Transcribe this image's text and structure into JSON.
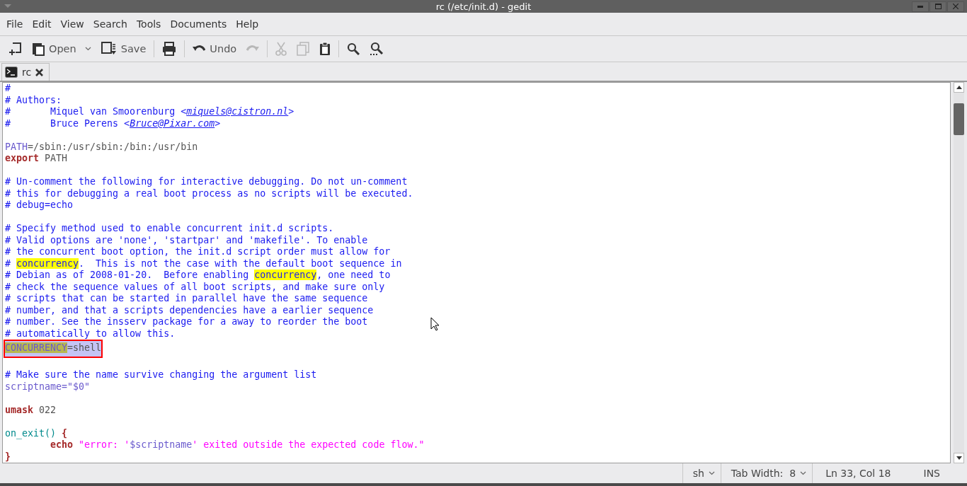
{
  "window": {
    "title": "rc (/etc/init.d) - gedit"
  },
  "menu": [
    {
      "label": "File"
    },
    {
      "label": "Edit"
    },
    {
      "label": "View"
    },
    {
      "label": "Search"
    },
    {
      "label": "Tools"
    },
    {
      "label": "Documents"
    },
    {
      "label": "Help"
    }
  ],
  "toolbar": [
    {
      "kind": "new",
      "disabled": false
    },
    {
      "kind": "open",
      "label": "Open",
      "disabled": false
    },
    {
      "kind": "save",
      "label": "Save",
      "disabled": false
    },
    {
      "kind": "separator"
    },
    {
      "kind": "print",
      "disabled": false
    },
    {
      "kind": "separator"
    },
    {
      "kind": "undo",
      "label": "Undo",
      "disabled": false
    },
    {
      "kind": "redo",
      "disabled": true
    },
    {
      "kind": "separator"
    },
    {
      "kind": "cut",
      "disabled": true
    },
    {
      "kind": "copy",
      "disabled": true
    },
    {
      "kind": "paste",
      "disabled": false
    },
    {
      "kind": "separator"
    },
    {
      "kind": "find",
      "disabled": false
    },
    {
      "kind": "replace",
      "disabled": false
    }
  ],
  "tabs": [
    {
      "label": "rc",
      "selected": true
    }
  ],
  "code": {
    "lines": [
      {
        "selected": false,
        "boxed": false,
        "segments": [
          {
            "text": "#",
            "kind": "comment",
            "match": false
          }
        ]
      },
      {
        "selected": false,
        "boxed": false,
        "segments": [
          {
            "text": "# Authors:",
            "kind": "comment",
            "match": false
          }
        ]
      },
      {
        "selected": false,
        "boxed": false,
        "segments": [
          {
            "text": "#\tMiquel van Smoorenburg <",
            "kind": "comment",
            "match": false
          },
          {
            "text": "miquels@cistron.nl",
            "kind": "link",
            "match": false
          },
          {
            "text": ">",
            "kind": "comment",
            "match": false
          }
        ]
      },
      {
        "selected": false,
        "boxed": false,
        "segments": [
          {
            "text": "#\tBruce Perens <",
            "kind": "comment",
            "match": false
          },
          {
            "text": "Bruce@Pixar.com",
            "kind": "link",
            "match": false
          },
          {
            "text": ">",
            "kind": "comment",
            "match": false
          }
        ]
      },
      {
        "selected": false,
        "boxed": false
      },
      {
        "selected": false,
        "boxed": false,
        "segments": [
          {
            "text": "PATH",
            "kind": "variable",
            "match": false
          },
          {
            "text": "=/sbin:/usr/sbin:/bin:/usr/bin",
            "kind": "plain",
            "match": false
          }
        ]
      },
      {
        "selected": false,
        "boxed": false,
        "segments": [
          {
            "text": "export",
            "kind": "keyword",
            "match": false
          },
          {
            "text": " PATH",
            "kind": "plain",
            "match": false
          }
        ]
      },
      {
        "selected": false,
        "boxed": false
      },
      {
        "selected": false,
        "boxed": false,
        "segments": [
          {
            "text": "# Un-comment the following for interactive debugging. Do not un-comment",
            "kind": "comment",
            "match": false
          }
        ]
      },
      {
        "selected": false,
        "boxed": false,
        "segments": [
          {
            "text": "# this for debugging a real boot process as no scripts will be executed.",
            "kind": "comment",
            "match": false
          }
        ]
      },
      {
        "selected": false,
        "boxed": false,
        "segments": [
          {
            "text": "# debug=echo",
            "kind": "comment",
            "match": false
          }
        ]
      },
      {
        "selected": false,
        "boxed": false
      },
      {
        "selected": false,
        "boxed": false,
        "segments": [
          {
            "text": "# Specify method used to enable concurrent init.d scripts.",
            "kind": "comment",
            "match": false
          }
        ]
      },
      {
        "selected": false,
        "boxed": false,
        "segments": [
          {
            "text": "# Valid options are 'none', 'startpar' and 'makefile'. To enable",
            "kind": "comment",
            "match": false
          }
        ]
      },
      {
        "selected": false,
        "boxed": false,
        "segments": [
          {
            "text": "# the concurrent boot option, the init.d script order must allow for",
            "kind": "comment",
            "match": false
          }
        ]
      },
      {
        "selected": false,
        "boxed": false,
        "segments": [
          {
            "text": "# ",
            "kind": "comment",
            "match": false
          },
          {
            "text": "concurrency",
            "kind": "comment",
            "match": true
          },
          {
            "text": ".  This is not the case with the default boot sequence in",
            "kind": "comment",
            "match": false
          }
        ]
      },
      {
        "selected": false,
        "boxed": false,
        "segments": [
          {
            "text": "# Debian as of 2008-01-20.  Before enabling ",
            "kind": "comment",
            "match": false
          },
          {
            "text": "concurrency",
            "kind": "comment",
            "match": true
          },
          {
            "text": ", one need to",
            "kind": "comment",
            "match": false
          }
        ]
      },
      {
        "selected": false,
        "boxed": false,
        "segments": [
          {
            "text": "# check the sequence values of all boot scripts, and make sure only",
            "kind": "comment",
            "match": false
          }
        ]
      },
      {
        "selected": false,
        "boxed": false,
        "segments": [
          {
            "text": "# scripts that can be started in parallel have the same sequence",
            "kind": "comment",
            "match": false
          }
        ]
      },
      {
        "selected": false,
        "boxed": false,
        "segments": [
          {
            "text": "# number, and that a scripts dependencies have a earlier sequence",
            "kind": "comment",
            "match": false
          }
        ]
      },
      {
        "selected": false,
        "boxed": false,
        "segments": [
          {
            "text": "# number. See the insserv package for a away to reorder the boot",
            "kind": "comment",
            "match": false
          }
        ]
      },
      {
        "selected": false,
        "boxed": false,
        "segments": [
          {
            "text": "# automatically to allow this.",
            "kind": "comment",
            "match": false
          }
        ]
      },
      {
        "selected": true,
        "boxed": true,
        "segments": [
          {
            "text": "CONCURRENCY",
            "kind": "variable",
            "match": true
          },
          {
            "text": "=shell",
            "kind": "plain",
            "match": false
          }
        ]
      },
      {
        "selected": false,
        "boxed": false
      },
      {
        "selected": false,
        "boxed": false,
        "segments": [
          {
            "text": "# Make sure the name survive changing the argument list",
            "kind": "comment",
            "match": false
          }
        ]
      },
      {
        "selected": false,
        "boxed": false,
        "segments": [
          {
            "text": "scriptname=\"$0\"",
            "kind": "variable",
            "match": false
          }
        ]
      },
      {
        "selected": false,
        "boxed": false
      },
      {
        "selected": false,
        "boxed": false,
        "segments": [
          {
            "text": "umask",
            "kind": "keyword",
            "match": false
          },
          {
            "text": " 022",
            "kind": "plain",
            "match": false
          }
        ]
      },
      {
        "selected": false,
        "boxed": false
      },
      {
        "selected": false,
        "boxed": false,
        "segments": [
          {
            "text": "on_exit()",
            "kind": "function",
            "match": false
          },
          {
            "text": " {",
            "kind": "keyword",
            "match": false
          }
        ]
      },
      {
        "selected": false,
        "boxed": false,
        "segments": [
          {
            "text": "\techo",
            "kind": "keyword",
            "match": false
          },
          {
            "text": " \"error: '",
            "kind": "string",
            "match": false
          },
          {
            "text": "$scriptname",
            "kind": "variable",
            "match": false
          },
          {
            "text": "' exited outside the expected code flow.\"",
            "kind": "string",
            "match": false
          }
        ]
      },
      {
        "selected": false,
        "boxed": false,
        "segments": [
          {
            "text": "}",
            "kind": "keyword",
            "match": false
          }
        ]
      }
    ]
  },
  "status_bar": [
    {
      "kind": "dropdown",
      "label": "sh"
    },
    {
      "kind": "dropdown",
      "label": "Tab Width:  8"
    },
    {
      "kind": "text",
      "label": "Ln 33, Col 18"
    },
    {
      "kind": "text",
      "label": "INS"
    }
  ]
}
